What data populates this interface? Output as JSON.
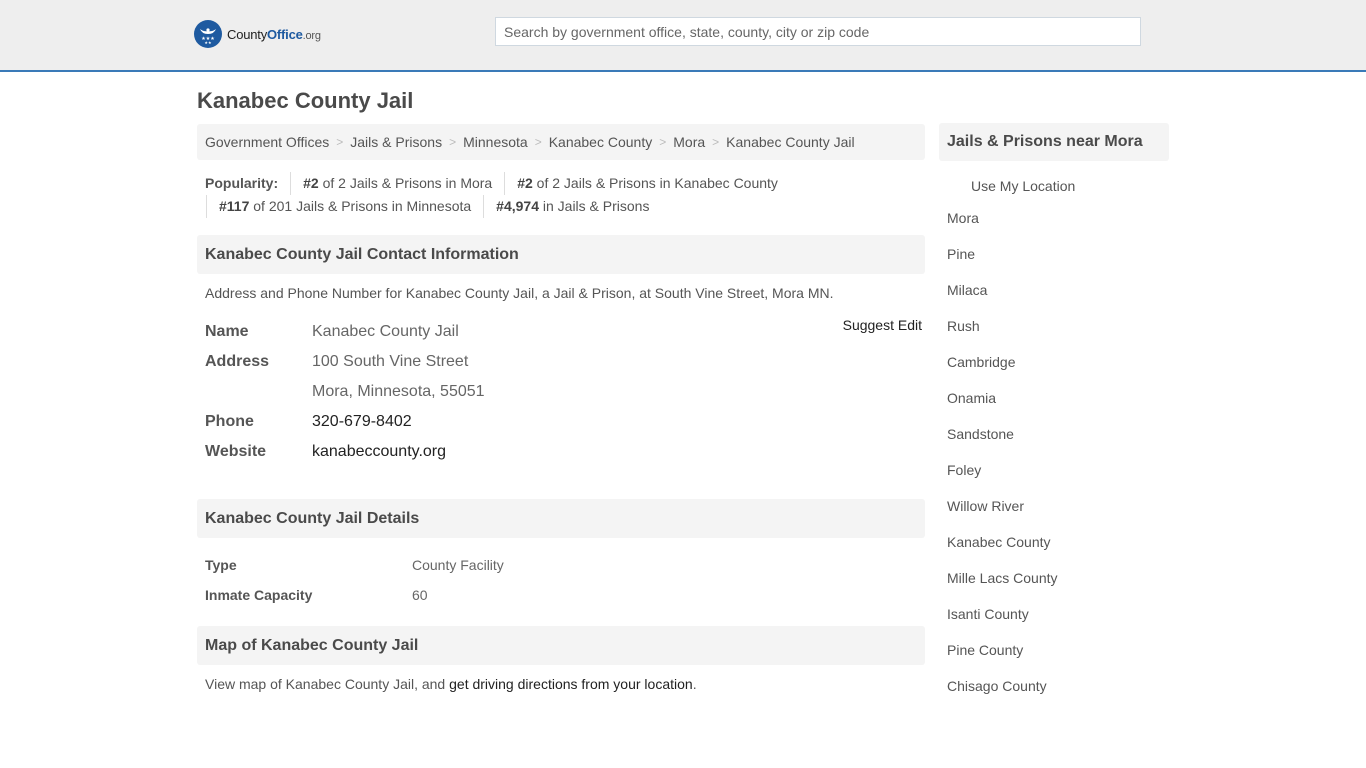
{
  "header": {
    "logo": {
      "county": "County",
      "office": "Office",
      "tld": ".org"
    },
    "search": {
      "placeholder": "Search by government office, state, county, city or zip code",
      "value": ""
    }
  },
  "page_title": "Kanabec County Jail",
  "breadcrumb": [
    "Government Offices",
    "Jails & Prisons",
    "Minnesota",
    "Kanabec County",
    "Mora",
    "Kanabec County Jail"
  ],
  "popularity": {
    "label": "Popularity:",
    "items": [
      {
        "rank": "#2",
        "text": " of 2 Jails & Prisons in Mora"
      },
      {
        "rank": "#2",
        "text": " of 2 Jails & Prisons in Kanabec County"
      },
      {
        "rank": "#117",
        "text": " of 201 Jails & Prisons in Minnesota"
      },
      {
        "rank": "#4,974",
        "text": " in Jails & Prisons"
      }
    ]
  },
  "contact": {
    "heading": "Kanabec County Jail Contact Information",
    "description": "Address and Phone Number for Kanabec County Jail, a Jail & Prison, at South Vine Street, Mora MN.",
    "suggest_edit": "Suggest Edit",
    "name_label": "Name",
    "name": "Kanabec County Jail",
    "address_label": "Address",
    "address_line1": "100 South Vine Street",
    "address_line2": "Mora, Minnesota, 55051",
    "phone_label": "Phone",
    "phone": "320-679-8402",
    "website_label": "Website",
    "website": "kanabeccounty.org"
  },
  "details": {
    "heading": "Kanabec County Jail Details",
    "rows": [
      {
        "label": "Type",
        "value": "County Facility"
      },
      {
        "label": "Inmate Capacity",
        "value": "60"
      }
    ]
  },
  "map": {
    "heading": "Map of Kanabec County Jail",
    "text_before": "View map of Kanabec County Jail, and ",
    "link": "get driving directions from your location",
    "text_after": "."
  },
  "sidebar": {
    "heading": "Jails & Prisons near Mora",
    "use_location": "Use My Location",
    "links": [
      "Mora",
      "Pine",
      "Milaca",
      "Rush",
      "Cambridge",
      "Onamia",
      "Sandstone",
      "Foley",
      "Willow River",
      "Kanabec County",
      "Mille Lacs County",
      "Isanti County",
      "Pine County",
      "Chisago County"
    ]
  },
  "colors": {
    "accent": "#3a7ab8",
    "logo_blue": "#1e5aa0",
    "header_bg": "#eeeeee",
    "panel_bg": "#f4f4f4"
  }
}
